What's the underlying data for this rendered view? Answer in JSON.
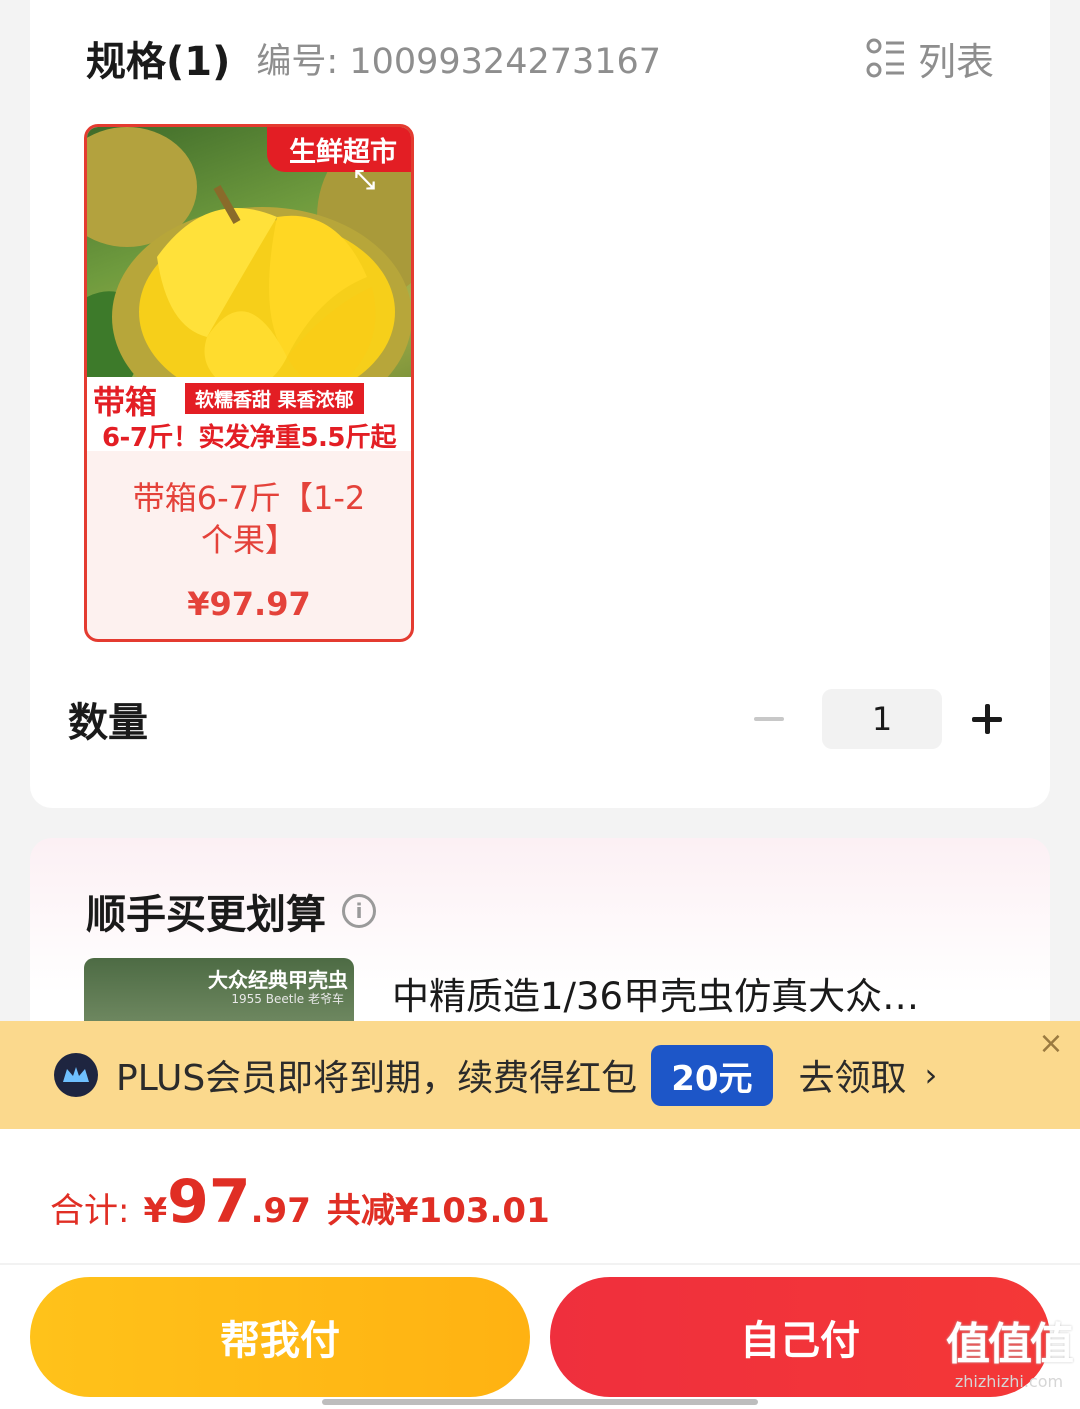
{
  "spec": {
    "title": "规格(1)",
    "code": "编号: 10099324273167",
    "view_toggle_label": "列表",
    "sku": {
      "corner_tag": "生鲜超市",
      "strip_tag_box": "带箱",
      "strip_tag_features": "软糯香甜  果香浓郁",
      "strip_tag_weight": "6-7斤！实发净重5.5斤起",
      "name": "带箱6-7斤【1-2个果】",
      "price": "¥97.97"
    },
    "quantity": {
      "label": "数量",
      "value": "1"
    }
  },
  "addon": {
    "title": "顺手买更划算",
    "thumb_title": "大众经典甲壳虫",
    "thumb_subtitle": "1955 Beetle 老爷车",
    "product_name": "中精质造1/36甲壳虫仿真大众…"
  },
  "plus_banner": {
    "text": "PLUS会员即将到期，续费得红包",
    "badge": "20元",
    "cta": "去领取",
    "arrow": "›",
    "close": "×"
  },
  "checkout": {
    "total_label": "合计:",
    "currency": "¥",
    "total_int": "97",
    "total_dec": ".97",
    "discount": "共减¥103.01",
    "help_pay_label": "帮我付",
    "self_pay_label": "自己付"
  },
  "watermark": {
    "main": "值值值",
    "sub": "zhizhizhi.com"
  },
  "colors": {
    "accent_red": "#e02e24",
    "help_pay_yellow": "#ffb91a",
    "self_pay_red": "#f1333b",
    "plus_banner_bg": "#fbd98d",
    "plus_badge_blue": "#1d56c8"
  }
}
